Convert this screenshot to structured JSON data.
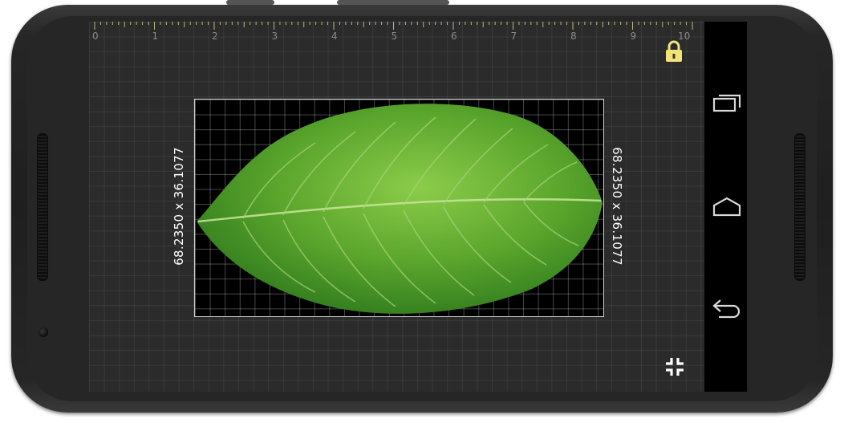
{
  "ruler": {
    "labels": [
      "0",
      "1",
      "2",
      "3",
      "4",
      "5",
      "6",
      "7",
      "8",
      "9",
      "10"
    ]
  },
  "measurement": {
    "left_label": "68.2350 x 36.1077",
    "right_label": "68.2350 x 36.1077"
  },
  "icons": {
    "lock": "lock-icon",
    "shrink": "exit-fullscreen-icon",
    "recents": "recent-apps-icon",
    "home": "home-icon",
    "back": "back-icon"
  },
  "colors": {
    "lock": "#f1e27a",
    "leaf_light": "#7cc13f",
    "leaf_dark": "#2f7a1d",
    "ruler_tick": "#b9b97a"
  }
}
